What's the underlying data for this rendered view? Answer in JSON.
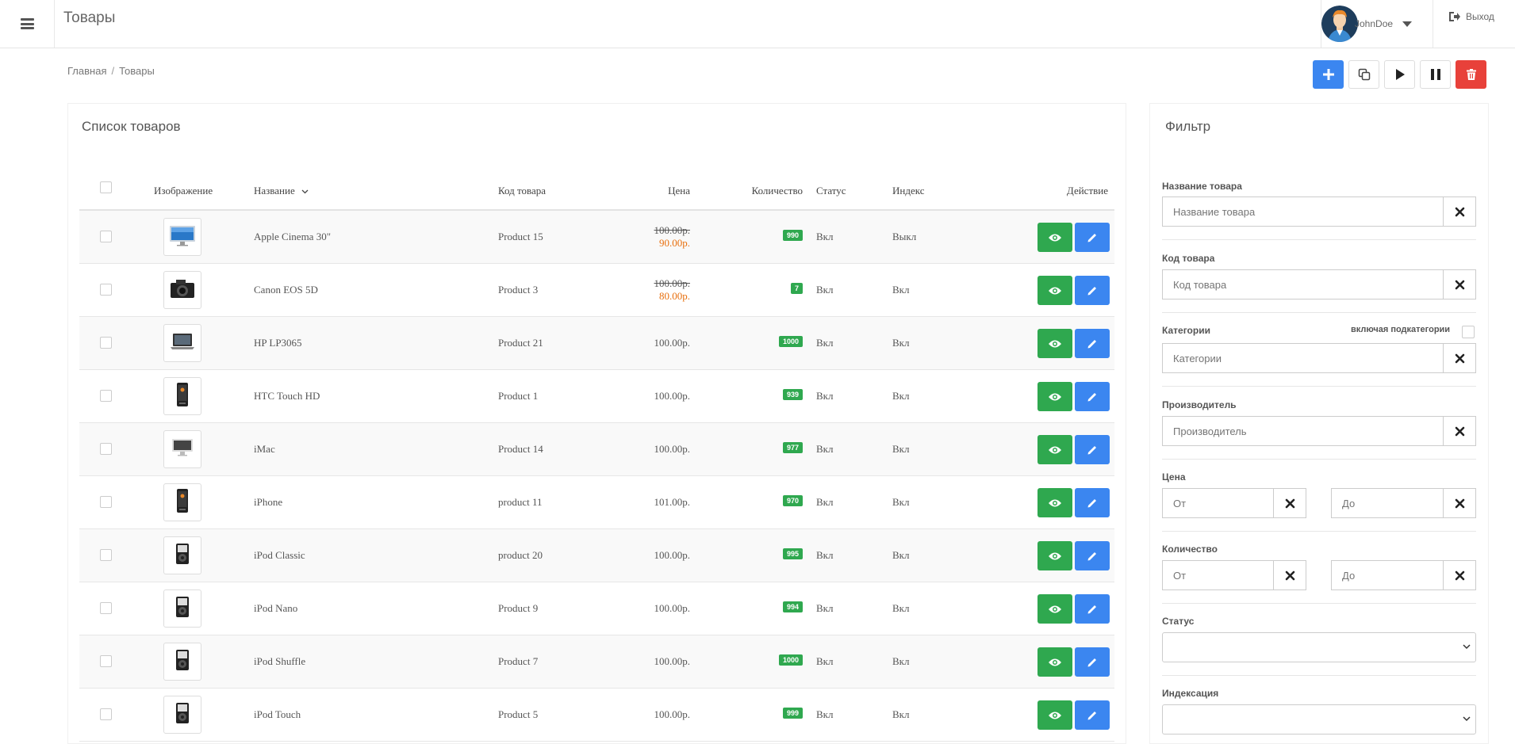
{
  "header": {
    "title": "Товары",
    "user_name": "JohnDoe",
    "logout_label": "Выход"
  },
  "breadcrumb": [
    "Главная",
    "Товары"
  ],
  "colors": {
    "primary": "#3b86f0",
    "success": "#2fa84f",
    "danger": "#e8413a",
    "sale_price": "#e8700f"
  },
  "product_list": {
    "title": "Список товаров",
    "columns": {
      "image": "Изображение",
      "name": "Название",
      "code": "Код товара",
      "price": "Цена",
      "quantity": "Количество",
      "status": "Статус",
      "index": "Индекс",
      "action": "Действие"
    },
    "rows": [
      {
        "name": "Apple Cinema 30\"",
        "code": "Product 15",
        "price": "100.00р.",
        "special": "90.00р.",
        "quantity": "990",
        "status": "Вкл",
        "index": "Выкл",
        "image_icon": "monitor-icon"
      },
      {
        "name": "Canon EOS 5D",
        "code": "Product 3",
        "price": "100.00р.",
        "special": "80.00р.",
        "quantity": "7",
        "status": "Вкл",
        "index": "Вкл",
        "image_icon": "camera-icon"
      },
      {
        "name": "HP LP3065",
        "code": "Product 21",
        "price": "100.00р.",
        "special": "",
        "quantity": "1000",
        "status": "Вкл",
        "index": "Вкл",
        "image_icon": "laptop-icon"
      },
      {
        "name": "HTC Touch HD",
        "code": "Product 1",
        "price": "100.00р.",
        "special": "",
        "quantity": "939",
        "status": "Вкл",
        "index": "Вкл",
        "image_icon": "phone-icon"
      },
      {
        "name": "iMac",
        "code": "Product 14",
        "price": "100.00р.",
        "special": "",
        "quantity": "977",
        "status": "Вкл",
        "index": "Вкл",
        "image_icon": "desktop-icon"
      },
      {
        "name": "iPhone",
        "code": "product 11",
        "price": "101.00р.",
        "special": "",
        "quantity": "970",
        "status": "Вкл",
        "index": "Вкл",
        "image_icon": "phone-icon"
      },
      {
        "name": "iPod Classic",
        "code": "product 20",
        "price": "100.00р.",
        "special": "",
        "quantity": "995",
        "status": "Вкл",
        "index": "Вкл",
        "image_icon": "player-icon"
      },
      {
        "name": "iPod Nano",
        "code": "Product 9",
        "price": "100.00р.",
        "special": "",
        "quantity": "994",
        "status": "Вкл",
        "index": "Вкл",
        "image_icon": "player-icon"
      },
      {
        "name": "iPod Shuffle",
        "code": "Product 7",
        "price": "100.00р.",
        "special": "",
        "quantity": "1000",
        "status": "Вкл",
        "index": "Вкл",
        "image_icon": "player-icon"
      },
      {
        "name": "iPod Touch",
        "code": "Product 5",
        "price": "100.00р.",
        "special": "",
        "quantity": "999",
        "status": "Вкл",
        "index": "Вкл",
        "image_icon": "player-icon"
      }
    ]
  },
  "filter": {
    "title": "Фильтр",
    "name_label": "Название товара",
    "name_placeholder": "Название товара",
    "code_label": "Код товара",
    "code_placeholder": "Код товара",
    "category_label": "Категории",
    "subcategories_label": "включая подкатегории",
    "category_placeholder": "Категории",
    "manufacturer_label": "Производитель",
    "manufacturer_placeholder": "Производитель",
    "price_label": "Цена",
    "from_placeholder": "От",
    "to_placeholder": "До",
    "quantity_label": "Количество",
    "status_label": "Статус",
    "indexing_label": "Индексация"
  }
}
